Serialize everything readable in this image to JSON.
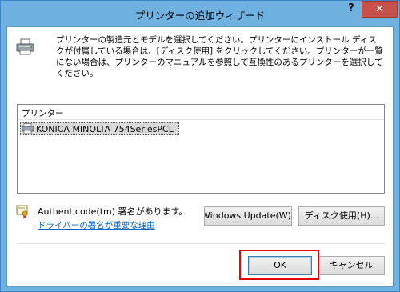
{
  "window": {
    "title": "プリンターの追加ウィザード",
    "help_label": "?",
    "close_label": "✕"
  },
  "instruction": "プリンターの製造元とモデルを選択してください。プリンターにインストール ディスクが付属している場合は、[ディスク使用] をクリックしてください。プリンターが一覧にない場合は、プリンターのマニュアルを参照して互換性のあるプリンターを選択してください。",
  "printer_list": {
    "header": "プリンター",
    "items": [
      "KONICA MINOLTA 754SeriesPCL"
    ]
  },
  "signature": {
    "status": "Authenticode(tm) 署名があります。",
    "link": "ドライバーの署名が重要な理由"
  },
  "buttons": {
    "windows_update": "Windows Update(W)",
    "have_disk": "ディスク使用(H)...",
    "ok": "OK",
    "cancel": "キャンセル"
  },
  "colors": {
    "title_bar": "#6fb1e0",
    "close_button": "#c7504a",
    "link": "#0066cc",
    "annotation_highlight": "#e8000b"
  }
}
